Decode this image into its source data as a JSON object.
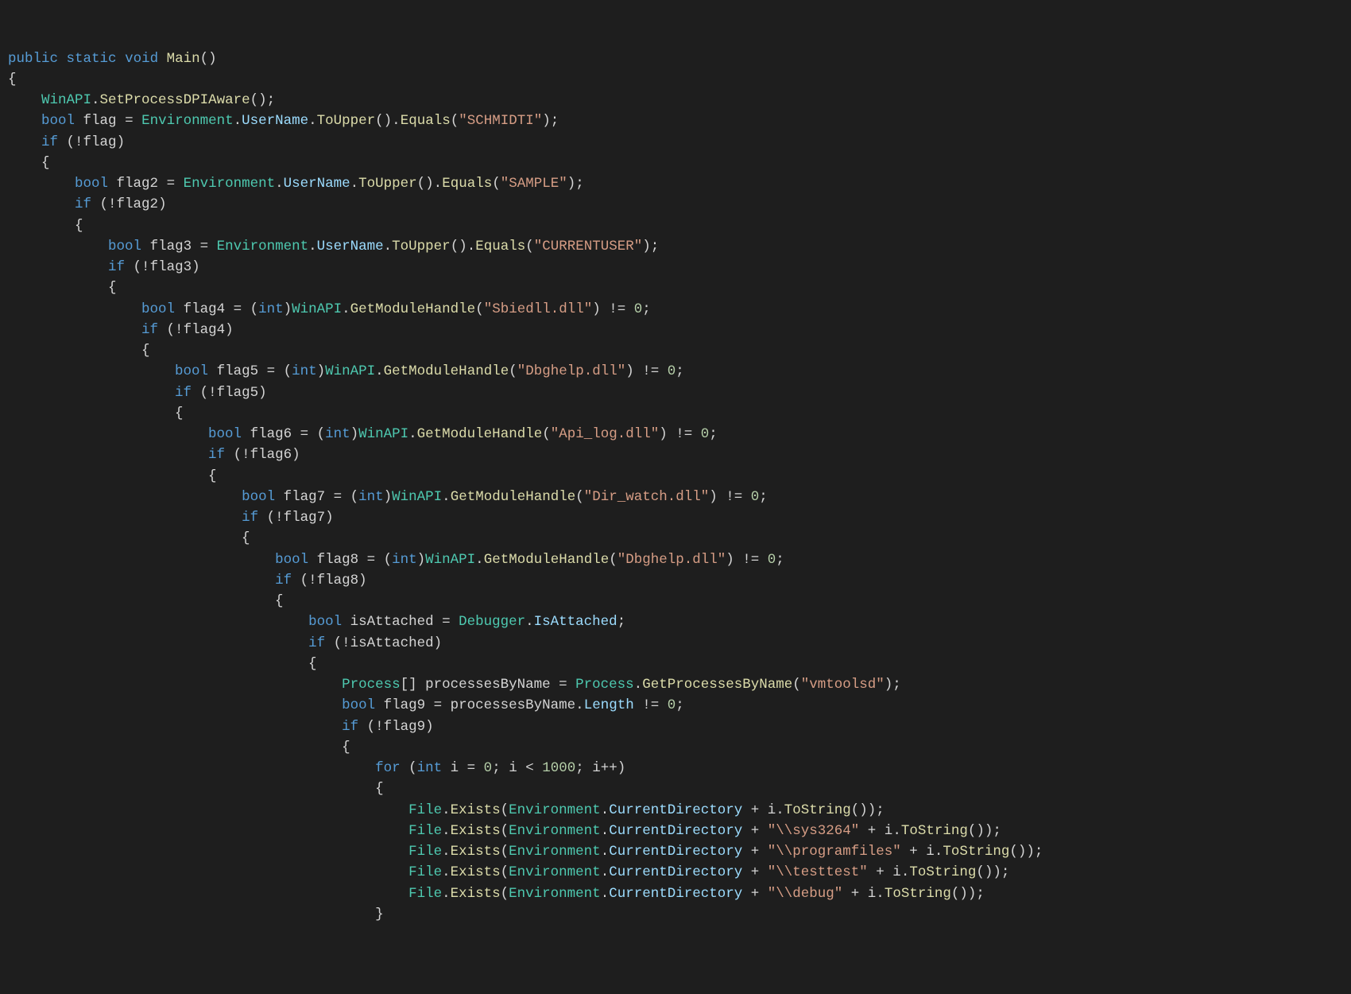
{
  "code": {
    "signature": {
      "kw_public": "public",
      "kw_static": "static",
      "kw_void": "void",
      "name": "Main"
    },
    "kw": {
      "bool": "bool",
      "if": "if",
      "int": "int",
      "for": "for"
    },
    "types": {
      "WinAPI": "WinAPI",
      "Environment": "Environment",
      "Process": "Process",
      "Debugger": "Debugger",
      "File": "File"
    },
    "props": {
      "UserName": "UserName",
      "CurrentDirectory": "CurrentDirectory",
      "IsAttached": "IsAttached",
      "Length": "Length"
    },
    "meth": {
      "SetProcessDPIAware": "SetProcessDPIAware",
      "ToUpper": "ToUpper",
      "Equals": "Equals",
      "GetModuleHandle": "GetModuleHandle",
      "GetProcessesByName": "GetProcessesByName",
      "Exists": "Exists",
      "ToString": "ToString"
    },
    "vars": {
      "flag": "flag",
      "flag2": "flag2",
      "flag3": "flag3",
      "flag4": "flag4",
      "flag5": "flag5",
      "flag6": "flag6",
      "flag7": "flag7",
      "flag8": "flag8",
      "flag9": "flag9",
      "isAttached": "isAttached",
      "processesByName": "processesByName",
      "i": "i"
    },
    "strings": {
      "schmidti": "\"SCHMIDTI\"",
      "sample": "\"SAMPLE\"",
      "currentuser": "\"CURRENTUSER\"",
      "sbiedll": "\"Sbiedll.dll\"",
      "dbghelp": "\"Dbghelp.dll\"",
      "apilog": "\"Api_log.dll\"",
      "dirwatch": "\"Dir_watch.dll\"",
      "vmtoolsd": "\"vmtoolsd\"",
      "sys3264": "\"\\\\sys3264\"",
      "programfiles": "\"\\\\programfiles\"",
      "testtest": "\"\\\\testtest\"",
      "debug": "\"\\\\debug\""
    },
    "nums": {
      "zero": "0",
      "thousand": "1000"
    }
  }
}
